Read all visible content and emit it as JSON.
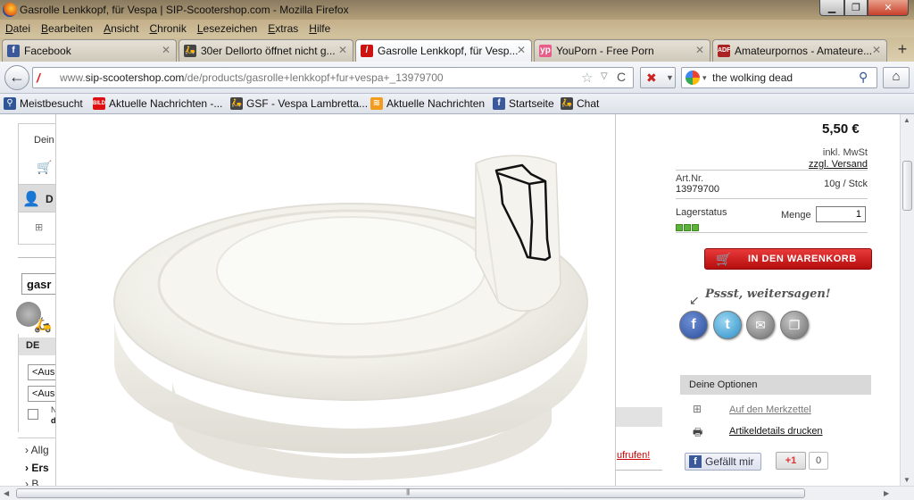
{
  "window": {
    "title": "Gasrolle Lenkkopf, für Vespa | SIP-Scootershop.com - Mozilla Firefox",
    "controls": {
      "minimize": "▁",
      "maximize": "❐",
      "close": "✕"
    }
  },
  "menu": [
    {
      "label": "Datei",
      "accel": "D",
      "rest": "atei"
    },
    {
      "label": "Bearbeiten",
      "accel": "B",
      "rest": "earbeiten"
    },
    {
      "label": "Ansicht",
      "accel": "A",
      "rest": "nsicht"
    },
    {
      "label": "Chronik",
      "accel": "C",
      "rest": "hronik"
    },
    {
      "label": "Lesezeichen",
      "accel": "L",
      "rest": "esezeichen"
    },
    {
      "label": "Extras",
      "accel": "E",
      "rest": "xtras"
    },
    {
      "label": "Hilfe",
      "accel": "H",
      "rest": "ilfe"
    }
  ],
  "tabs": [
    {
      "label": "Facebook",
      "icon": "f",
      "icon_color": "#3b5998",
      "active": false
    },
    {
      "label": "30er Dellorto öffnet nicht g...",
      "icon": "🛵",
      "icon_color": "#444444",
      "active": false
    },
    {
      "label": "Gasrolle Lenkkopf, für Vesp...",
      "icon": "/",
      "icon_color": "#cc1111",
      "active": true
    },
    {
      "label": "YouPorn - Free Porn",
      "icon": "yp",
      "icon_color": "#e85d8a",
      "active": false
    },
    {
      "label": "Amateurpornos - Amateure...",
      "icon": "ADF",
      "icon_color": "#aa2222",
      "active": false
    }
  ],
  "new_tab": "+",
  "nav": {
    "back": "←",
    "url_prefix": "www.",
    "url_domain": "sip-scootershop.com",
    "url_path": "/de/products/gasrolle+lenkkopf+fur+vespa+_13979700",
    "bookmark_star": "☆",
    "dropdown": "▽",
    "reload": "C",
    "search_value": "the wolking dead",
    "search_icon": "⚲",
    "home": "⌂"
  },
  "bookmarks": [
    {
      "label": "Meistbesucht",
      "icon": "⚲",
      "icon_color": "#2f5597"
    },
    {
      "label": "Aktuelle Nachrichten -...",
      "icon": "BILD",
      "icon_color": "#dd1111"
    },
    {
      "label": "GSF - Vespa Lambretta...",
      "icon": "🛵",
      "icon_color": "#444444"
    },
    {
      "label": "Aktuelle Nachrichten",
      "icon": "≋",
      "icon_color": "#f29b1d"
    },
    {
      "label": "Startseite",
      "icon": "f",
      "icon_color": "#3b5998"
    },
    {
      "label": "Chat",
      "icon": "🛵",
      "icon_color": "#444444"
    }
  ],
  "left": {
    "box_text": "Dein",
    "dark_text": "D",
    "search_text": "gasr",
    "panel_header": "DE",
    "select1": "<Aus",
    "select2": "<Aus",
    "chk_line1": "N",
    "chk_line2": "d",
    "list": [
      "Allg",
      "Ers",
      "B"
    ],
    "list_bullets": [
      "›",
      "›",
      "›"
    ]
  },
  "middle": {
    "link": "ufrufen!"
  },
  "product": {
    "price": "5,50 €",
    "incl": "inkl. MwSt",
    "versand": "zzgl. Versand",
    "art_label": "Art.Nr.",
    "art_no": "13979700",
    "unit": "10g / Stck",
    "lager_label": "Lagerstatus",
    "stock_level": 3,
    "menge_label": "Menge",
    "menge_value": "1",
    "cart_button": "IN DEN WARENKORB"
  },
  "share": {
    "heading": "Pssst, weitersagen!",
    "fb": "f",
    "tw": "t",
    "mail": "✉",
    "copy": "❐"
  },
  "options": {
    "header": "Deine Optionen",
    "merkzettel": "Auf den Merkzettel",
    "drucken": "Artikeldetails drucken"
  },
  "social": {
    "fb_like": "Gefällt mir",
    "gplus": "+1",
    "gplus_count": "0"
  }
}
